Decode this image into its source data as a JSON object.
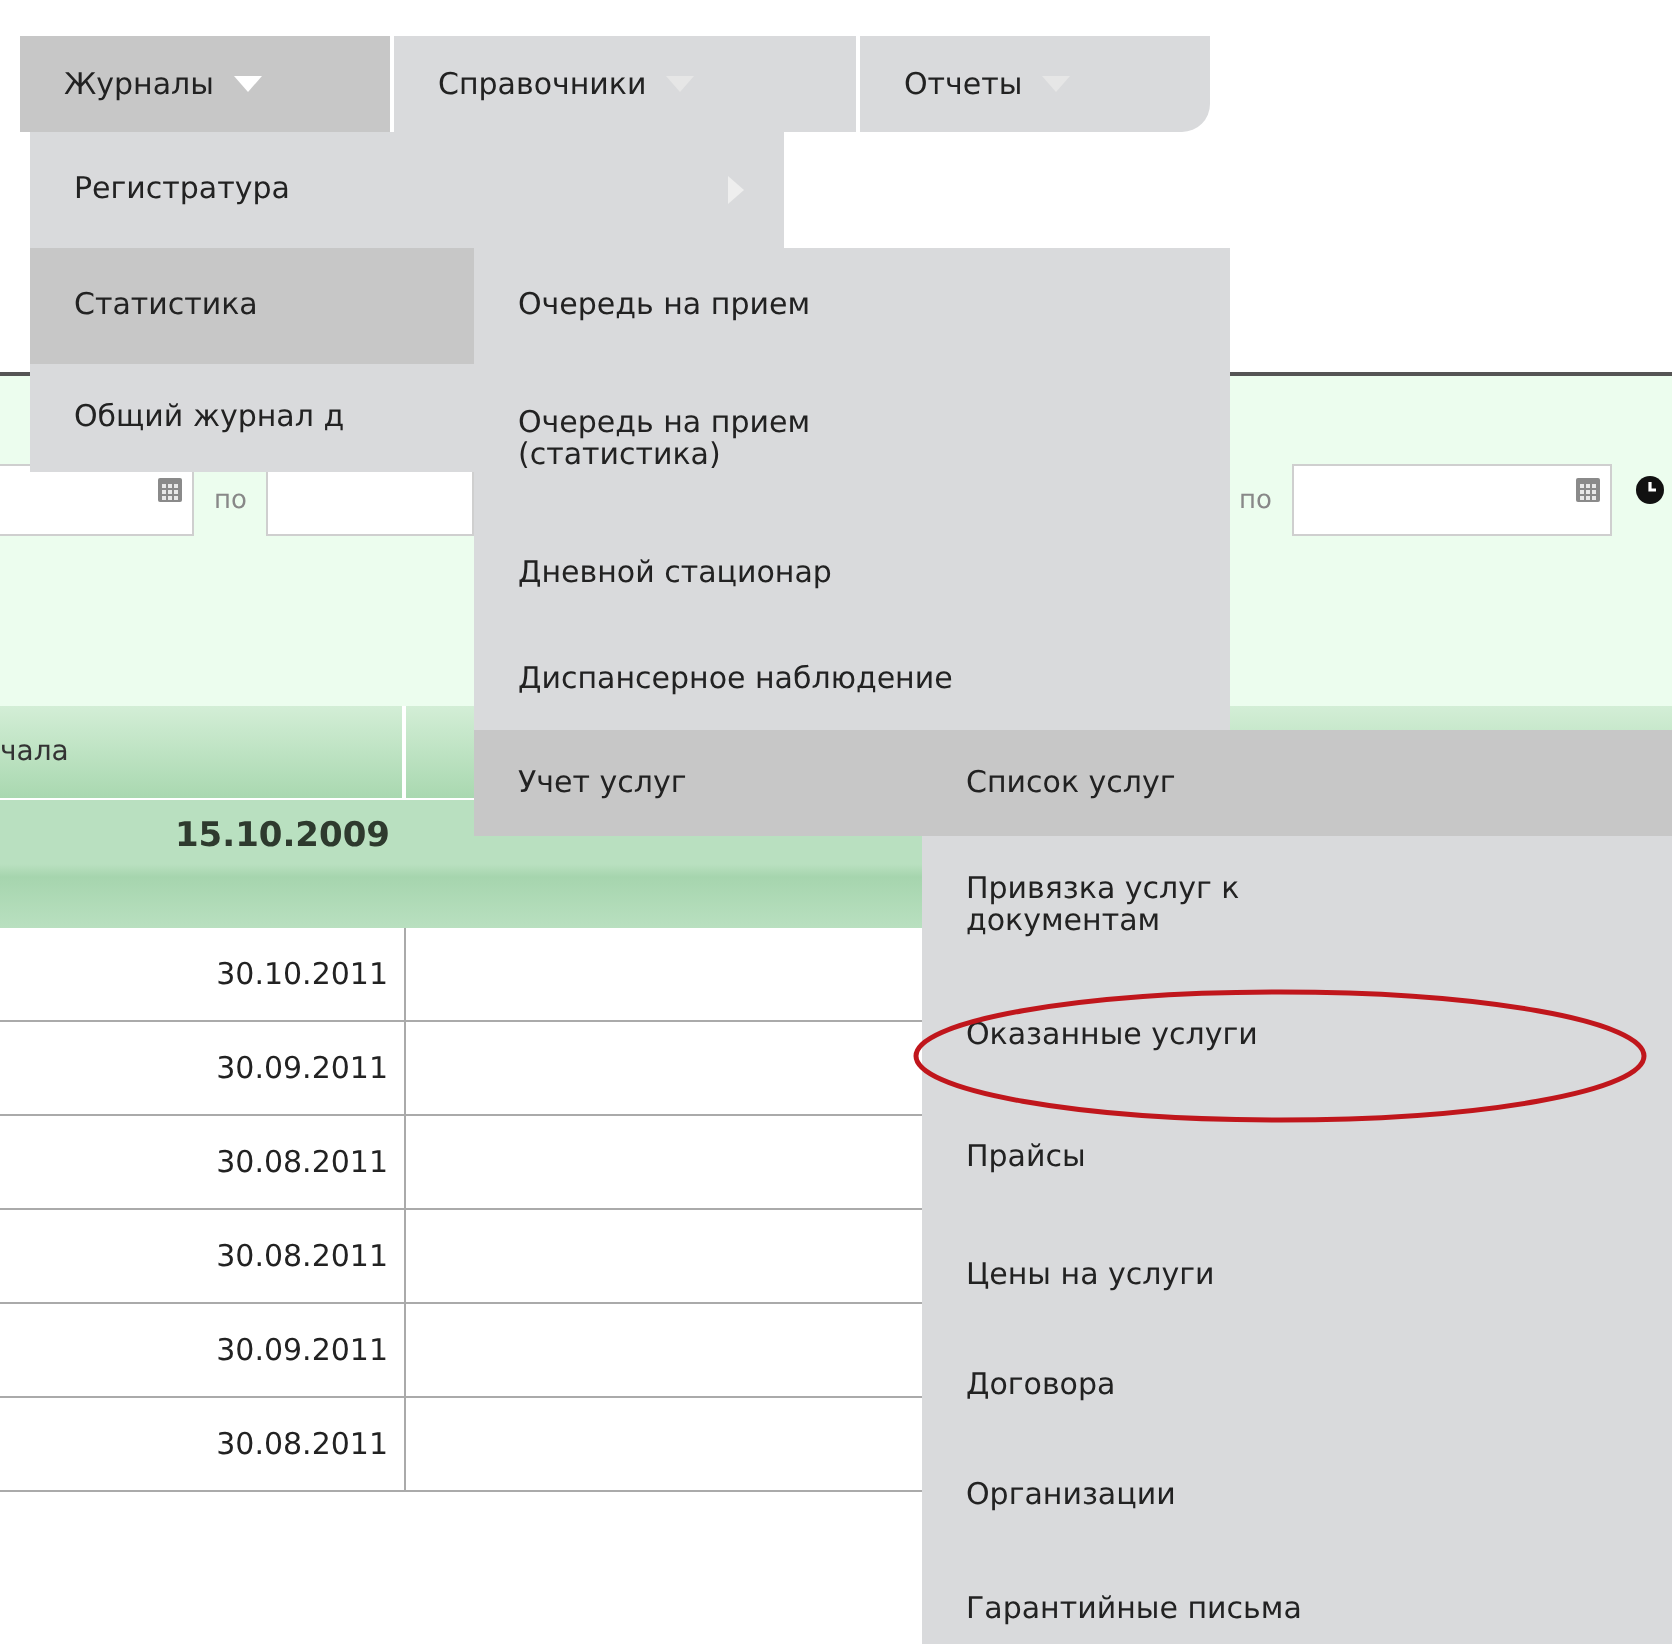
{
  "menubar": [
    {
      "label": "Журналы",
      "selected": true
    },
    {
      "label": "Справочники",
      "selected": false
    },
    {
      "label": "Отчеты",
      "selected": false
    }
  ],
  "filter": {
    "labels": [
      "по",
      "по"
    ]
  },
  "table": {
    "column_1": "чала",
    "group": "15.10.2009",
    "rows": [
      "30.10.2011",
      "30.09.2011",
      "30.08.2011",
      "30.08.2011",
      "30.09.2011",
      "30.08.2011"
    ]
  },
  "menus": [
    {
      "items": [
        {
          "label": "Регистратура",
          "selected": false,
          "arrow": true
        },
        {
          "label": "Статистика",
          "selected": true,
          "arrow": false
        },
        {
          "label": "Общий журнал д",
          "selected": false,
          "arrow": false
        }
      ]
    },
    {
      "items": [
        {
          "label": "Очередь на прием",
          "selected": false
        },
        {
          "label": "Очередь на прием (статистика)",
          "selected": false
        },
        {
          "label": "Дневной стационар",
          "selected": false
        },
        {
          "label": "Диспансерное наблюдение",
          "selected": false
        },
        {
          "label": "Учет услуг",
          "selected": true
        }
      ]
    },
    {
      "items": [
        {
          "label": "Список услуг",
          "selected": true,
          "circled": false
        },
        {
          "label": "Привязка услуг к документам",
          "selected": false,
          "circled": false
        },
        {
          "label": "Оказанные услуги",
          "selected": false,
          "circled": true
        },
        {
          "label": "Прайсы",
          "selected": false,
          "circled": false
        },
        {
          "label": "Цены на услуги",
          "selected": false,
          "circled": false
        },
        {
          "label": "Договора",
          "selected": false,
          "circled": false
        },
        {
          "label": "Организации",
          "selected": false,
          "circled": false
        },
        {
          "label": "Гарантийные письма",
          "selected": false,
          "circled": false
        }
      ]
    }
  ]
}
